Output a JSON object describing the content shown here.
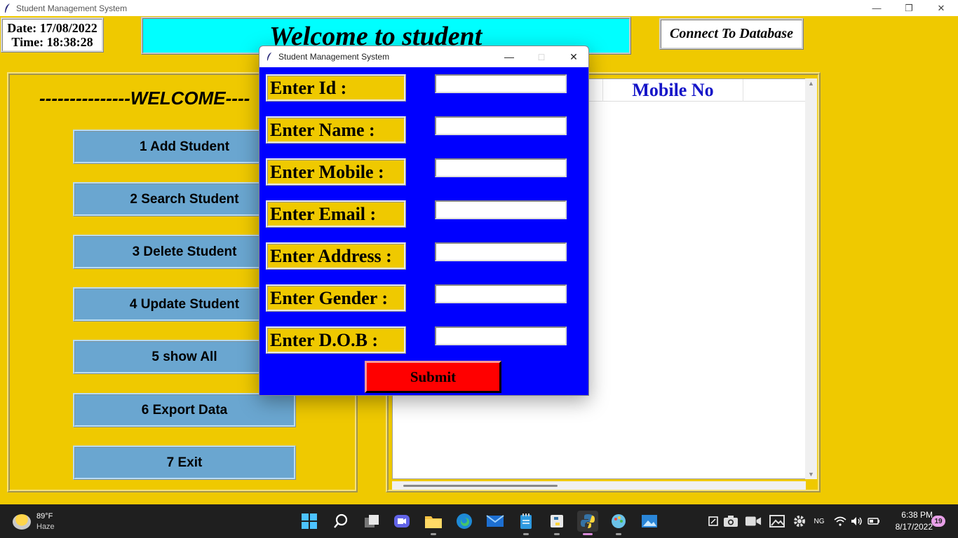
{
  "window": {
    "title": "Student Management System",
    "controls": [
      "—",
      "❐",
      "✕"
    ]
  },
  "datetime": {
    "date": "Date: 17/08/2022",
    "time": "Time: 18:38:28"
  },
  "banner": {
    "text": "Welcome to student"
  },
  "connect_button": "Connect To Database",
  "left_panel": {
    "welcome": "---------------WELCOME----",
    "menu": [
      "1 Add Student",
      "2 Search Student",
      "3 Delete Student",
      "4 Update Student",
      "5 show All",
      "6 Export Data",
      "7 Exit"
    ]
  },
  "table": {
    "columns": [
      "Mobile No"
    ],
    "scroll_up": "▲",
    "scroll_down": "▼"
  },
  "dialog": {
    "title": "Student Management System",
    "controls": [
      "—",
      "□",
      "✕"
    ],
    "fields": [
      {
        "label": "Enter Id :",
        "value": ""
      },
      {
        "label": "Enter Name :",
        "value": ""
      },
      {
        "label": "Enter Mobile :",
        "value": ""
      },
      {
        "label": "Enter Email :",
        "value": ""
      },
      {
        "label": "Enter Address :",
        "value": ""
      },
      {
        "label": "Enter Gender :",
        "value": ""
      },
      {
        "label": "Enter D.O.B :",
        "value": ""
      }
    ],
    "submit": "Submit"
  },
  "taskbar": {
    "weather": {
      "temp": "89°F",
      "condition": "Haze"
    },
    "tray_lang": "NG",
    "clock": {
      "time": "6:38 PM",
      "date": "8/17/2022"
    },
    "notifications": "19"
  },
  "colors": {
    "background": "#efc900",
    "banner": "#00ffff",
    "menu_button": "#6aa6d0",
    "dialog_bg": "#0000ff",
    "submit": "#ff0000",
    "column_header": "#1515c8"
  }
}
